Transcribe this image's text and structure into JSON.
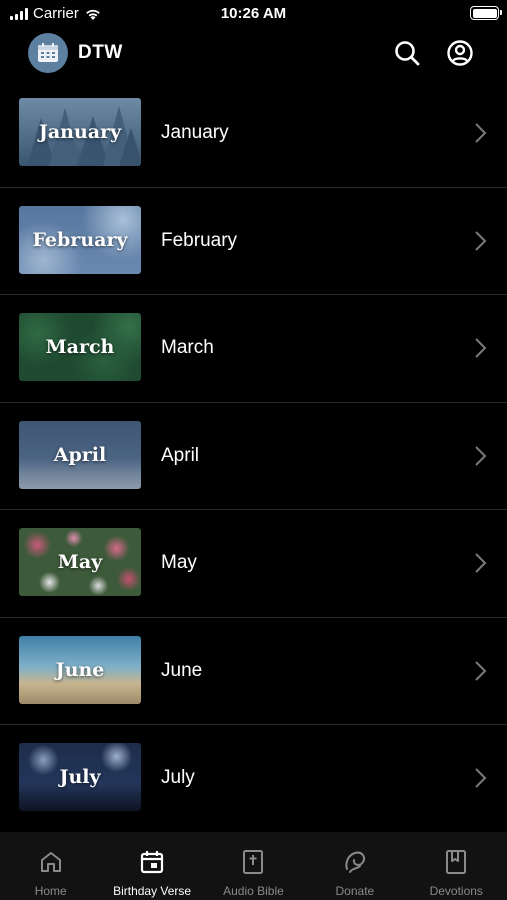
{
  "status_bar": {
    "carrier": "Carrier",
    "time": "10:26 AM"
  },
  "header": {
    "title": "DTW",
    "search_icon": "search-icon",
    "account_icon": "account-circle-icon"
  },
  "months": [
    {
      "thumb_text": "January",
      "label": "January",
      "theme": "snowy-forest"
    },
    {
      "thumb_text": "February",
      "label": "February",
      "theme": "cloudy-sky"
    },
    {
      "thumb_text": "March",
      "label": "March",
      "theme": "clover"
    },
    {
      "thumb_text": "April",
      "label": "April",
      "theme": "rain-flowers"
    },
    {
      "thumb_text": "May",
      "label": "May",
      "theme": "flower-field"
    },
    {
      "thumb_text": "June",
      "label": "June",
      "theme": "beach"
    },
    {
      "thumb_text": "July",
      "label": "July",
      "theme": "fireworks"
    }
  ],
  "tabs": [
    {
      "label": "Home",
      "icon": "home-icon",
      "active": false
    },
    {
      "label": "Birthday Verse",
      "icon": "calendar-icon",
      "active": true
    },
    {
      "label": "Audio Bible",
      "icon": "bible-icon",
      "active": false
    },
    {
      "label": "Donate",
      "icon": "donate-icon",
      "active": false
    },
    {
      "label": "Devotions",
      "icon": "bookmark-book-icon",
      "active": false
    }
  ]
}
